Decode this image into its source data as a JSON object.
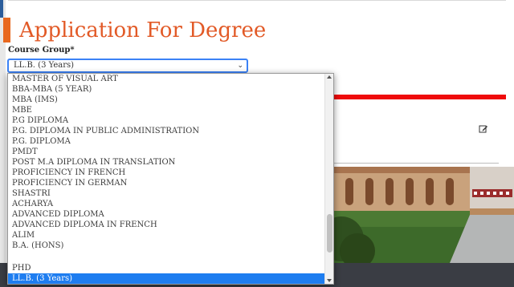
{
  "page": {
    "title": "Application For Degree",
    "course_group_label": "Course Group*"
  },
  "course_select": {
    "value": "LL.B. (3 Years)"
  },
  "dropdown": {
    "options": [
      "MASTER OF VISUAL ART",
      "BBA-MBA (5 YEAR)",
      "MBA (IMS)",
      "MBE",
      "P.G DIPLOMA",
      "P.G. DIPLOMA IN PUBLIC ADMINISTRATION",
      "P.G. DIPLOMA",
      "PMDT",
      "POST M.A DIPLOMA IN TRANSLATION",
      "PROFICIENCY IN FRENCH",
      "PROFICIENCY IN GERMAN",
      "SHASTRI",
      "ACHARYA",
      "ADVANCED DIPLOMA",
      "ADVANCED DIPLOMA IN FRENCH",
      "ALIM",
      "B.A. (HONS)",
      "",
      "PHD",
      "LL.B. (3 Years)"
    ],
    "selected_index": 19,
    "scroll_position": 0.72
  },
  "colors": {
    "title": "#e25a27",
    "accent": "#e8681f",
    "red_bar": "#ef0b0b",
    "selected_option": "#1e7df0",
    "footer": "#3a3d44"
  },
  "icons": {
    "edit": "edit-icon",
    "dropdown_chevron": "chevron-down-icon"
  }
}
